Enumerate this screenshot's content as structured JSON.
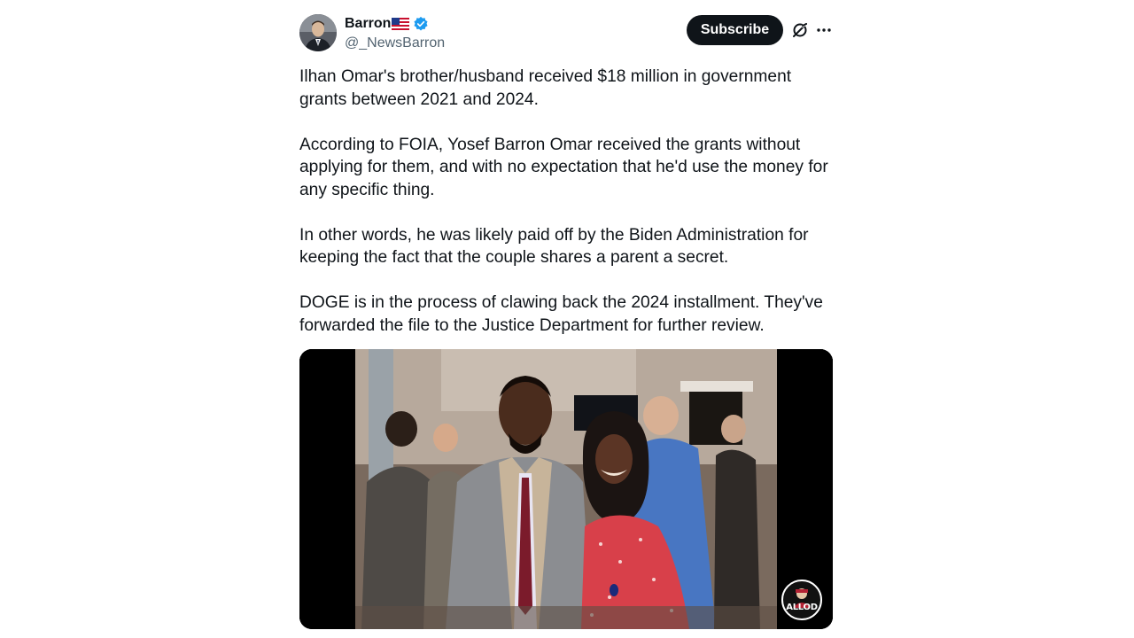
{
  "author": {
    "display_name": "Barron",
    "handle": "@_NewsBarron",
    "flag_icon": "us-flag-icon",
    "verified_icon": "verified-badge-icon",
    "verified_color": "#1d9bf0"
  },
  "actions": {
    "subscribe_label": "Subscribe",
    "grok_icon": "grok-icon",
    "more_icon": "more-options-icon"
  },
  "tweet": {
    "paragraphs": [
      "Ilhan Omar's brother/husband received $18 million in government grants between 2021 and 2024.",
      "According to FOIA, Yosef Barron Omar received the grants without applying for them, and with no expectation that he'd use the money for any specific thing.",
      "In other words, he was likely paid off by the Biden Administration for keeping the fact that the couple shares a parent a secret.",
      "DOGE is in the process of clawing back the 2024 installment. They've forwarded the file to the Justice Department for further review."
    ]
  },
  "media": {
    "watermark_text": "ALLOD"
  },
  "colors": {
    "text_primary": "#0f1419",
    "text_secondary": "#536471",
    "button_bg": "#0f1419",
    "button_text": "#ffffff"
  }
}
